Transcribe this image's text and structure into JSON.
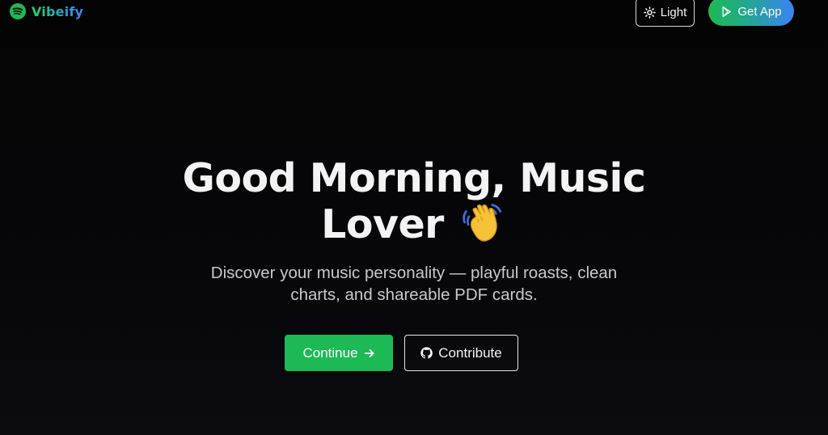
{
  "header": {
    "brand_name": "Vibeify",
    "brand_icon": "spotify-logo-icon",
    "theme_toggle_label": "Light",
    "theme_icon": "sun-icon",
    "get_app_label": "Get App",
    "get_app_icon": "google-play-icon"
  },
  "hero": {
    "title_line1": "Good Morning, Music",
    "title_line2": "Lover",
    "title_emoji": "waving-hand-icon",
    "subtitle_line1": "Discover your music personality — playful roasts, clean",
    "subtitle_line2": "charts, and shareable PDF cards."
  },
  "actions": {
    "continue_label": "Continue",
    "continue_icon": "arrow-right-icon",
    "contribute_label": "Contribute",
    "contribute_icon": "github-icon"
  },
  "colors": {
    "background": "#050506",
    "brand_green": "#1db954",
    "gradient_blue": "#3b82f6",
    "text_primary": "#f3f3f3",
    "text_secondary": "#c9c9c9"
  }
}
